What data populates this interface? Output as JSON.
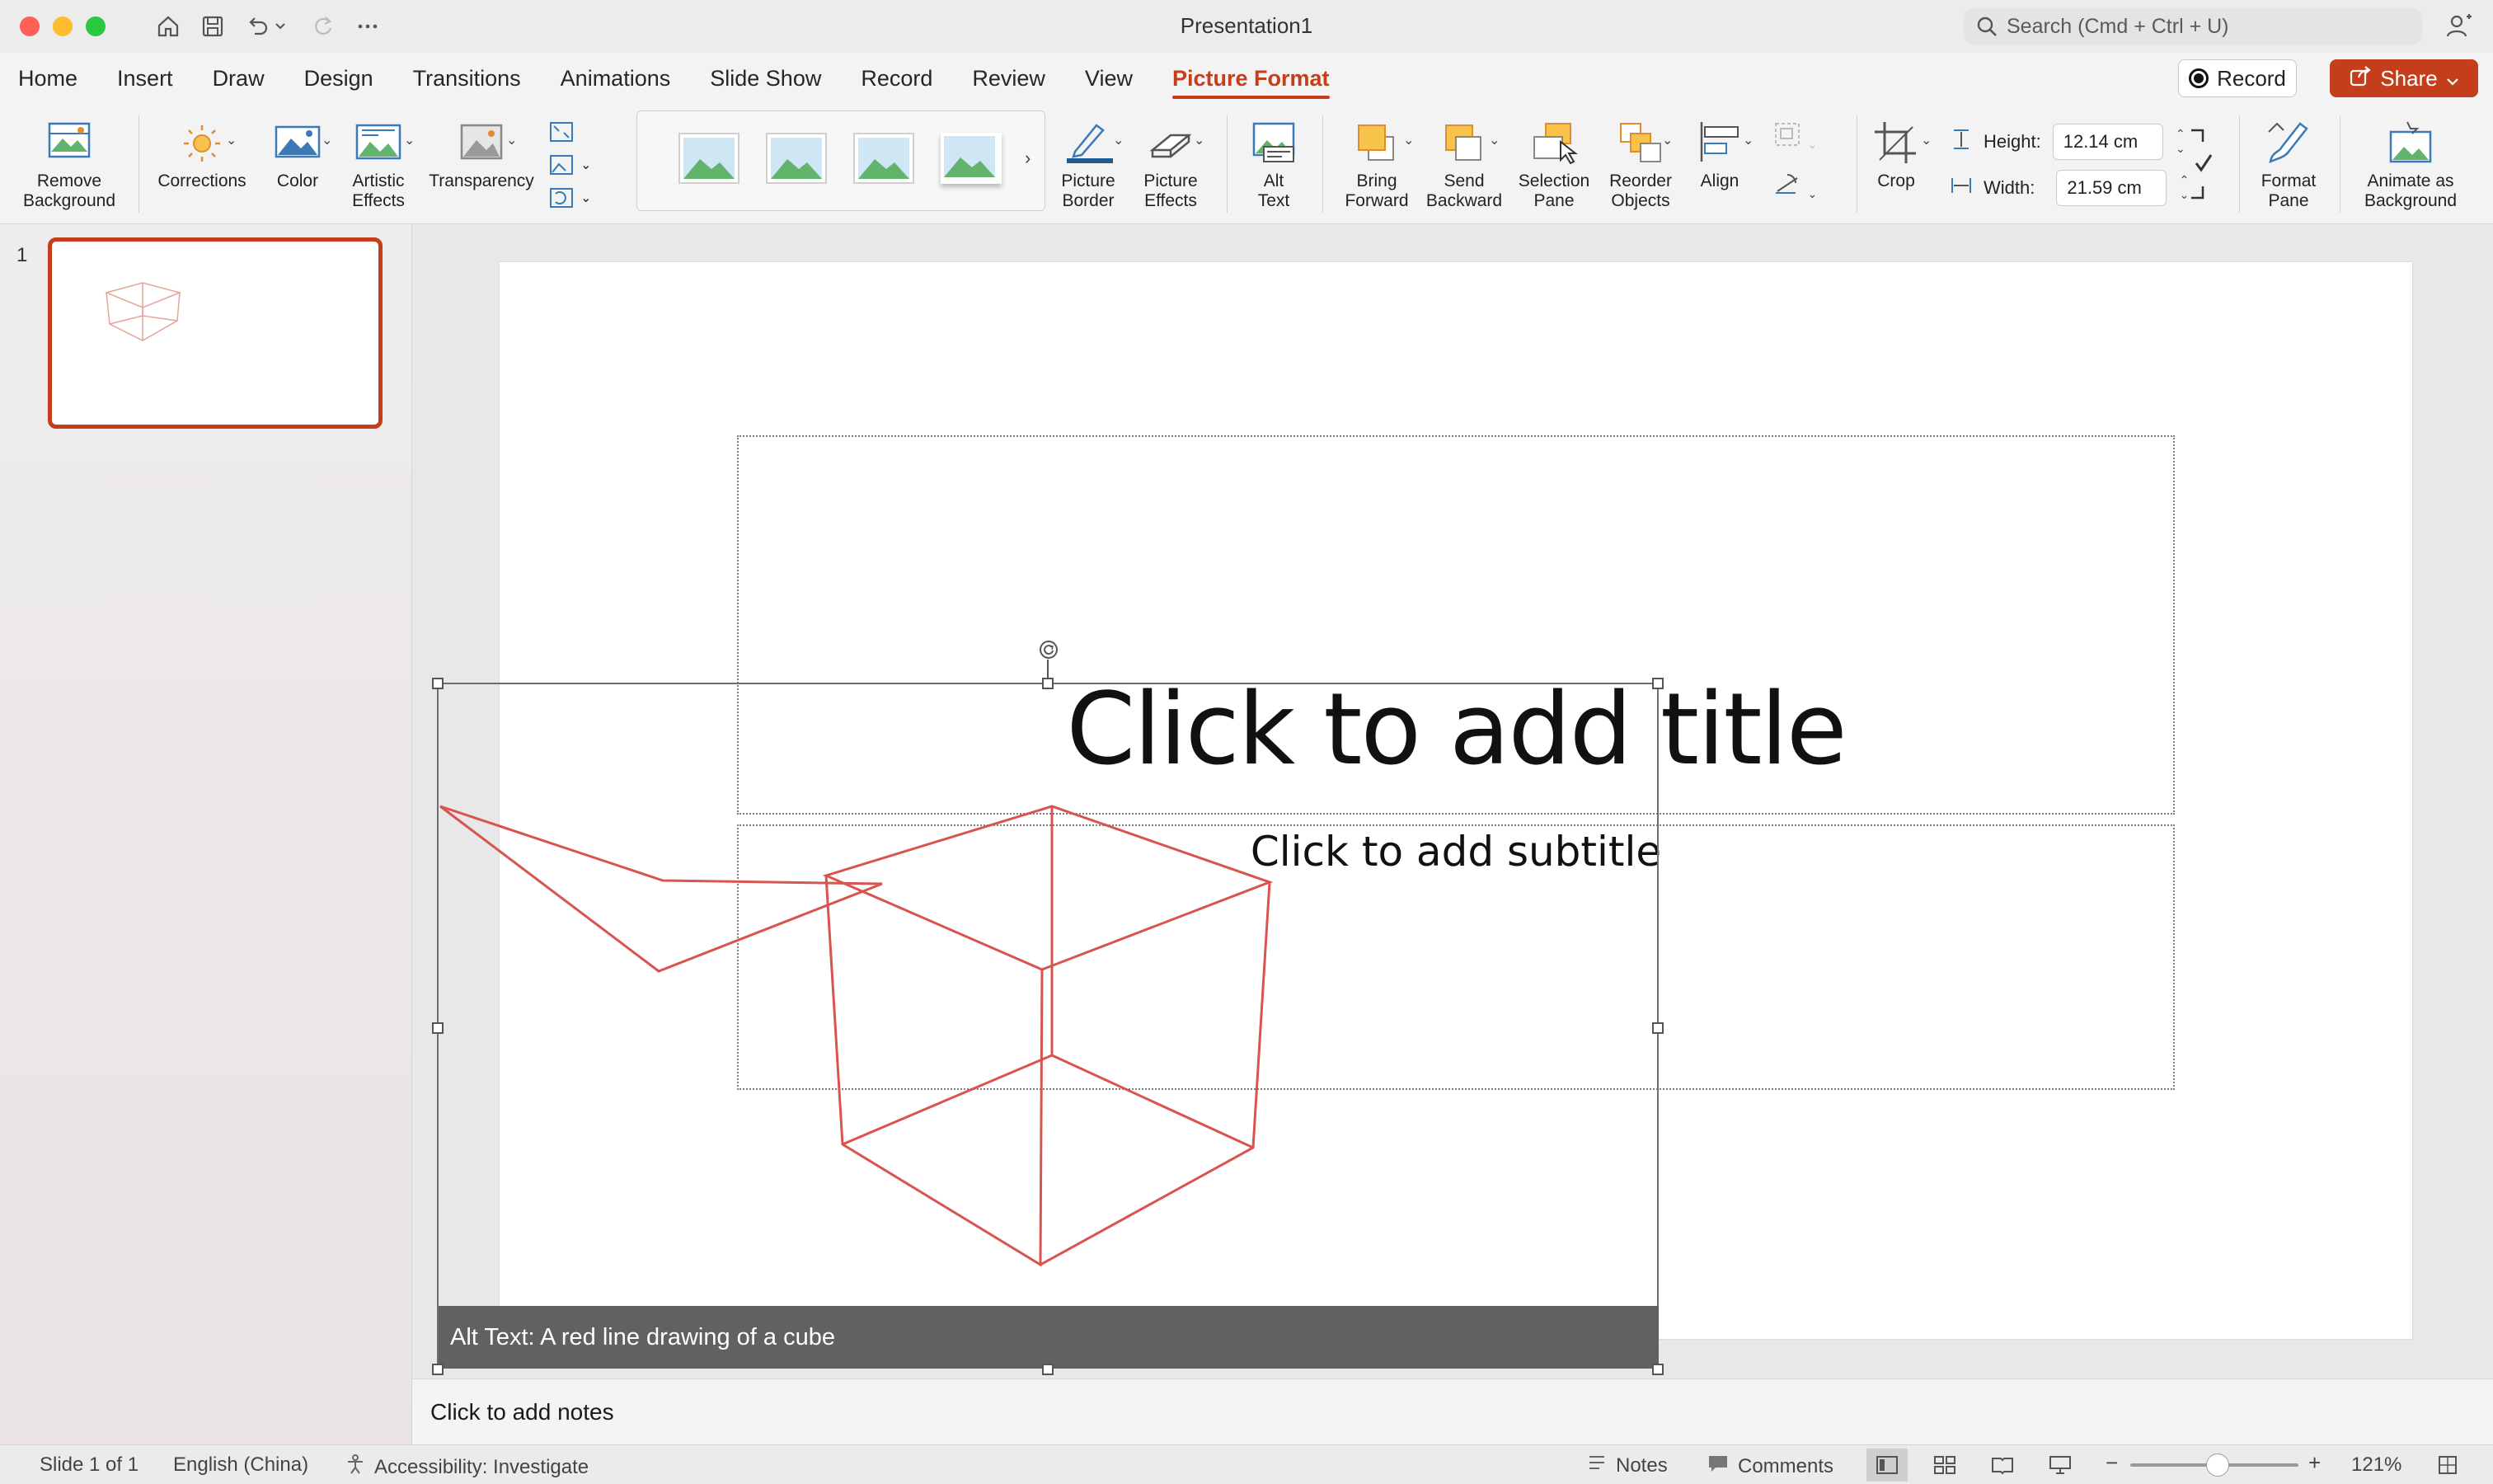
{
  "window": {
    "title": "Presentation1"
  },
  "search": {
    "placeholder": "Search (Cmd + Ctrl + U)"
  },
  "tabs": [
    {
      "label": "Home"
    },
    {
      "label": "Insert"
    },
    {
      "label": "Draw"
    },
    {
      "label": "Design"
    },
    {
      "label": "Transitions"
    },
    {
      "label": "Animations"
    },
    {
      "label": "Slide Show"
    },
    {
      "label": "Record"
    },
    {
      "label": "Review"
    },
    {
      "label": "View"
    },
    {
      "label": "Picture Format"
    }
  ],
  "header_actions": {
    "record_label": "Record",
    "share_label": "Share"
  },
  "ribbon": {
    "remove_background": "Remove\nBackground",
    "corrections": "Corrections",
    "color": "Color",
    "artistic_effects": "Artistic\nEffects",
    "transparency": "Transparency",
    "picture_border": "Picture\nBorder",
    "picture_effects": "Picture\nEffects",
    "alt_text": "Alt\nText",
    "bring_forward": "Bring\nForward",
    "send_backward": "Send\nBackward",
    "selection_pane": "Selection\nPane",
    "reorder_objects": "Reorder\nObjects",
    "align": "Align",
    "crop": "Crop",
    "height_label": "Height:",
    "height_value": "12.14 cm",
    "width_label": "Width:",
    "width_value": "21.59 cm",
    "format_pane": "Format\nPane",
    "animate_as_background": "Animate as\nBackground"
  },
  "slides_panel": {
    "slide_number": "1"
  },
  "slide": {
    "title_placeholder": "Click to add title",
    "subtitle_placeholder": "Click to add subtitle",
    "alt_text_overlay": "Alt Text: A red line drawing of a cube"
  },
  "notes": {
    "placeholder": "Click to add notes"
  },
  "status": {
    "slide_count": "Slide 1 of 1",
    "language": "English (China)",
    "accessibility": "Accessibility: Investigate",
    "notes_label": "Notes",
    "comments_label": "Comments",
    "zoom": "121%"
  },
  "colors": {
    "accent": "#c43e1c",
    "cube_stroke": "#d9534f"
  }
}
